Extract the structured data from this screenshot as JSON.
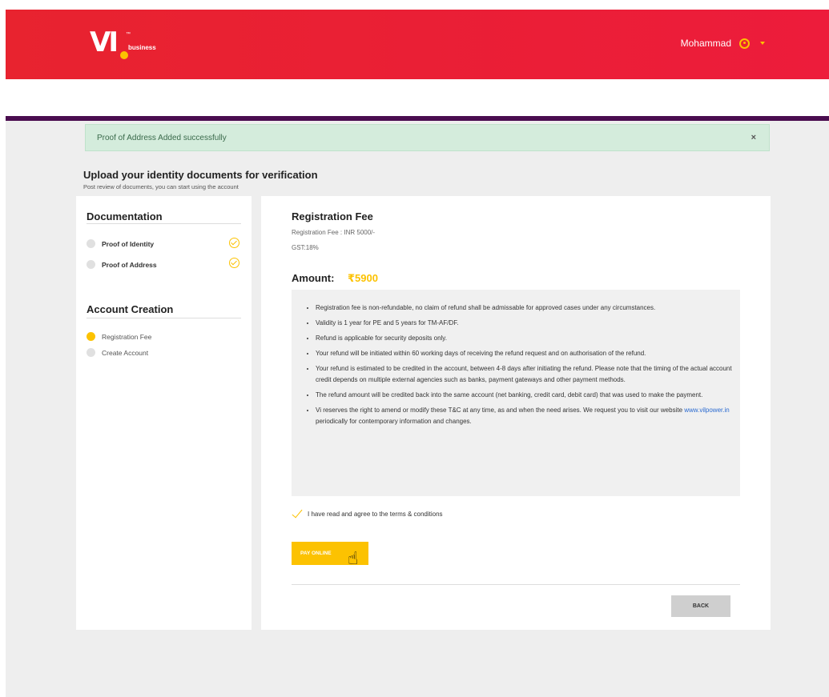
{
  "header": {
    "logo_text": "VI",
    "logo_sub": "business",
    "logo_tm": "™",
    "user_name": "Mohammad",
    "accent": "#fcc201",
    "brand_color": "#e8232f"
  },
  "alert": {
    "message": "Proof of Address Added successfully",
    "close_label": "×"
  },
  "page": {
    "title": "Upload your identity documents for verification",
    "subtitle": "Post review of documents, you can start using the account"
  },
  "sidebar": {
    "documentation_heading": "Documentation",
    "documentation_steps": [
      {
        "label": "Proof of Identity",
        "completed": true
      },
      {
        "label": "Proof of Address",
        "completed": true
      }
    ],
    "account_heading": "Account Creation",
    "account_steps": [
      {
        "label": "Registration Fee",
        "active": true
      },
      {
        "label": "Create Account",
        "active": false
      }
    ]
  },
  "registration": {
    "title": "Registration Fee",
    "fee_line": "Registration Fee : INR 5000/-",
    "gst_line": "GST:18%",
    "amount_label": "Amount:",
    "amount_value": "₹5900",
    "terms": [
      "Registration fee is non-refundable, no claim of refund shall be admissable for approved cases under any circumstances.",
      "Validity is 1 year for PE and 5 years for TM-AF/DF.",
      "Refund is applicable for security deposits only.",
      "Your refund will be initiated within 60 working days of receiving the refund request and on authorisation of the refund.",
      "Your refund is estimated to be credited in the account, between 4-8 days after initiating the refund. Please note that the timing of the actual account credit depends on multiple external agencies such as banks, payment gateways and other payment methods.",
      "The refund amount will be credited back into the same account (net banking, credit card, debit card) that was used to make the payment."
    ],
    "terms_last_prefix": "Vi reserves the right to amend or modify these T&C at any time, as and when the need arises. We request you to visit our website ",
    "terms_last_link": "www.vilpower.in",
    "terms_last_suffix": " periodically for contemporary information and changes.",
    "agree_label": "I have read and agree to the terms & conditions",
    "pay_label": "PAY ONLINE",
    "back_label": "BACK"
  }
}
